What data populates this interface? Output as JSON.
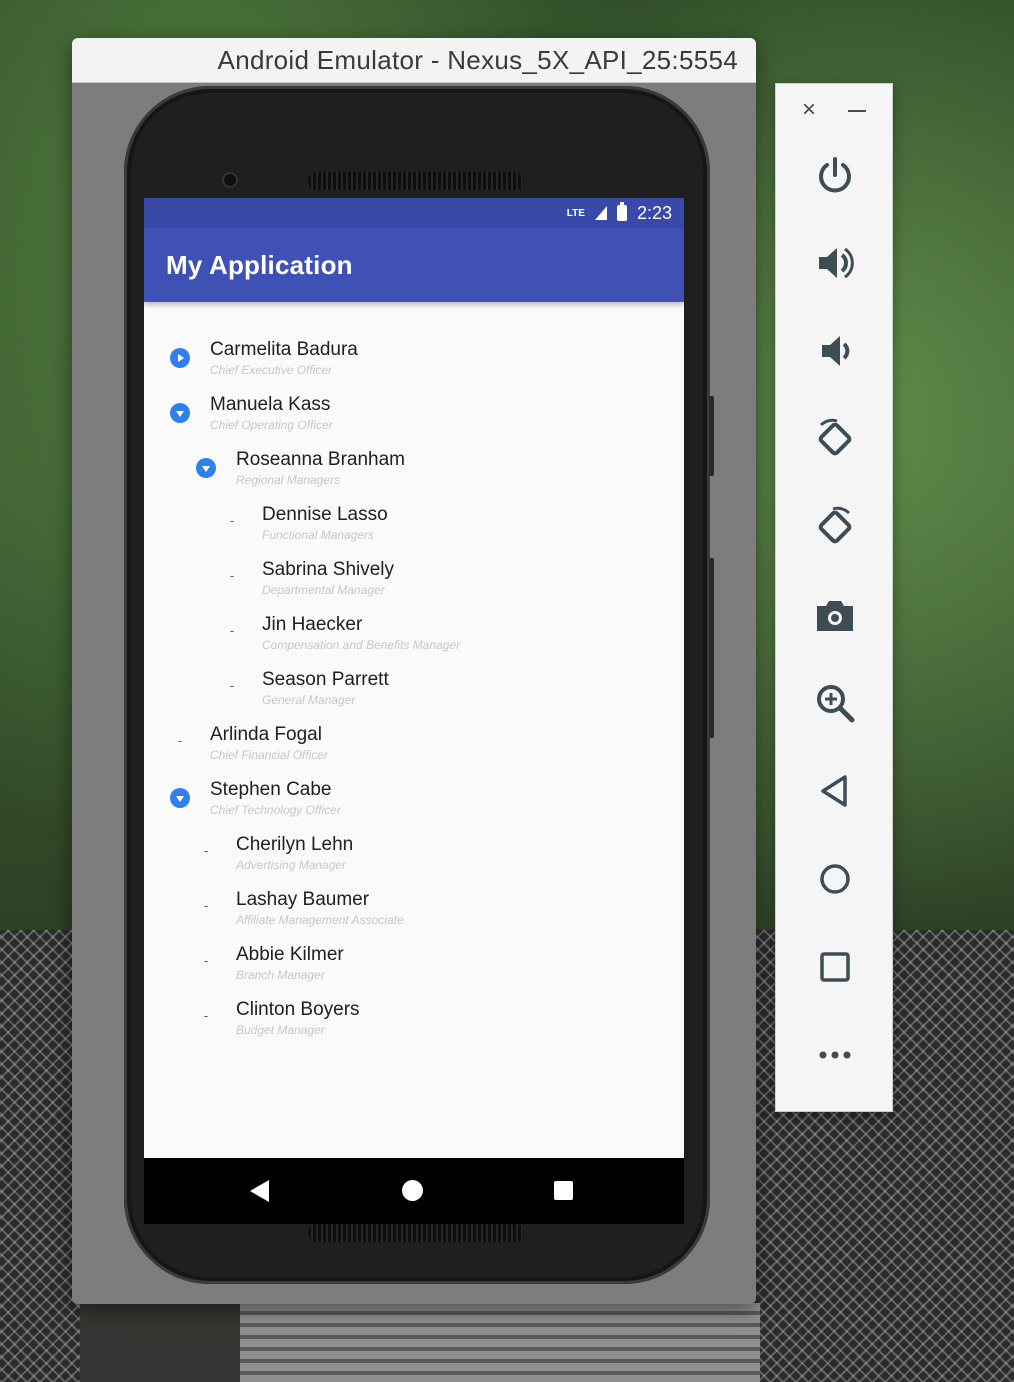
{
  "window": {
    "title": "Android Emulator - Nexus_5X_API_25:5554"
  },
  "status_bar": {
    "network": "LTE",
    "time": "2:23"
  },
  "app_bar": {
    "title": "My Application"
  },
  "tree": [
    {
      "name": "Carmelita Badura",
      "role": "Chief Executive Officer",
      "toggle": "collapsed"
    },
    {
      "name": "Manuela Kass",
      "role": "Chief Operating Officer",
      "toggle": "expanded"
    },
    {
      "name": "Roseanna Branham",
      "role": "Regional Managers",
      "toggle": "expanded"
    },
    {
      "name": "Dennise Lasso",
      "role": "Functional Managers",
      "toggle": "leaf"
    },
    {
      "name": "Sabrina Shively",
      "role": "Departmental Manager",
      "toggle": "leaf"
    },
    {
      "name": "Jin Haecker",
      "role": "Compensation and Benefits Manager",
      "toggle": "leaf"
    },
    {
      "name": "Season Parrett",
      "role": "General Manager",
      "toggle": "leaf"
    },
    {
      "name": "Arlinda Fogal",
      "role": "Chief Financial Officer",
      "toggle": "leaf"
    },
    {
      "name": "Stephen Cabe",
      "role": "Chief Technology Officer",
      "toggle": "expanded"
    },
    {
      "name": "Cherilyn Lehn",
      "role": "Advertising Manager",
      "toggle": "leaf"
    },
    {
      "name": "Lashay Baumer",
      "role": "Affiliate Management Associate",
      "toggle": "leaf"
    },
    {
      "name": "Abbie Kilmer",
      "role": "Branch Manager",
      "toggle": "leaf"
    },
    {
      "name": "Clinton Boyers",
      "role": "Budget Manager",
      "toggle": "leaf"
    }
  ],
  "leaf_marker": "-",
  "toolbar": {
    "close_glyph": "×",
    "buttons": [
      "power-icon",
      "volume-up-icon",
      "volume-down-icon",
      "rotate-left-icon",
      "rotate-right-icon",
      "camera-icon",
      "zoom-icon",
      "back-icon",
      "home-icon",
      "overview-icon",
      "more-icon"
    ]
  },
  "colors": {
    "status_bar": "#3849a8",
    "app_bar": "#3f51b5",
    "toggle": "#2f80ed",
    "toolbar_icon": "#3e4c54"
  }
}
